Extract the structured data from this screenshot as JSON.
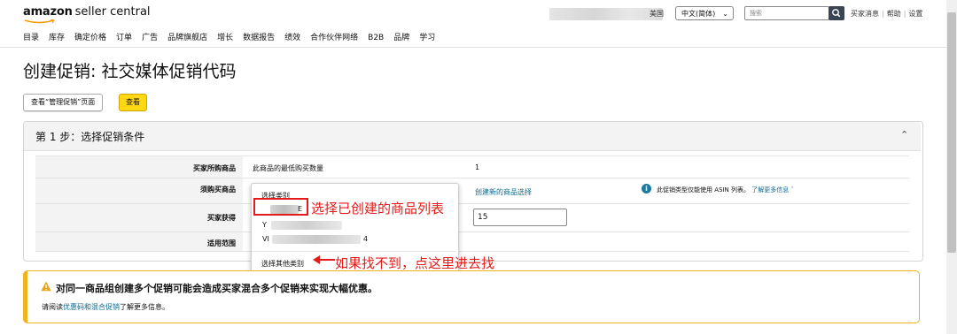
{
  "header": {
    "logo_bold": "amazon",
    "logo_rest": "seller central",
    "marketplace_suffix": "美国",
    "language": "中文(简体)",
    "search_placeholder": "搜索",
    "links": [
      "买家消息",
      "帮助",
      "设置"
    ]
  },
  "nav": {
    "items": [
      "目录",
      "库存",
      "确定价格",
      "订单",
      "广告",
      "品牌旗舰店",
      "增长",
      "数据报告",
      "绩效",
      "合作伙伴网络",
      "B2B",
      "品牌",
      "学习"
    ]
  },
  "page": {
    "title": "创建促销: 社交媒体促销代码",
    "view_manage_label": "查看“管理促销”页面",
    "view_label": "查看"
  },
  "step": {
    "title": "第 1 步：选择促销条件",
    "rows": [
      {
        "label": "买家所购商品",
        "value": "此商品的最低购买数量",
        "extra": "1"
      },
      {
        "label": "须购买商品",
        "value": "选择类别",
        "extra": "创建新的商品选择"
      },
      {
        "label": "买家获得",
        "value": "",
        "extra": "15"
      },
      {
        "label": "适用范围",
        "value": "",
        "extra": ""
      }
    ],
    "info_text": "此促销类型仅能使用 ASIN 列表。",
    "info_link": "了解更多信息"
  },
  "dropdown": {
    "header": "选择类别",
    "item1_suffix": "E",
    "item2_prefix": "Y",
    "item3_prefix": "VI",
    "item3_suffix": "4",
    "footer": "选择其他类别"
  },
  "annotations": {
    "select_list": "选择已创建的商品列表",
    "not_found": "如果找不到，点这里进去找"
  },
  "warning": {
    "title": "对同一商品组创建多个促销可能会造成买家混合多个促销来实现大幅优惠。",
    "body_prefix": "请阅读",
    "body_link": "优惠码和混合促销",
    "body_suffix": "了解更多信息。"
  },
  "colors": {
    "accent_link": "#0a6a8f",
    "annotation_red": "#e31b1b",
    "warning_border": "#f0b31d",
    "button_yellow": "#ffd814"
  }
}
